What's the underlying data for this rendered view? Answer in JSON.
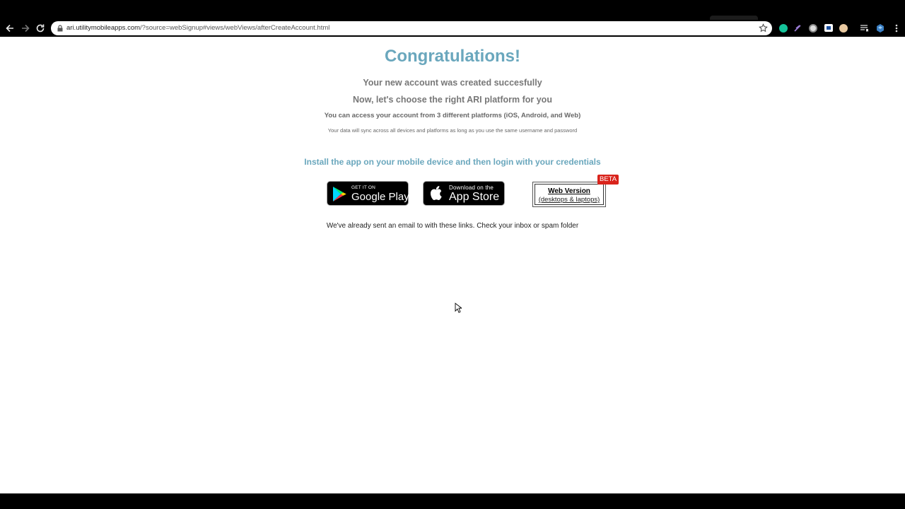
{
  "browser": {
    "url_host": "ari.utilitymobileapps.com",
    "url_rest": "/?source=webSignup#views/webViews/afterCreateAccount.html"
  },
  "page": {
    "title": "Congratulations!",
    "account_created": "Your new account was created succesfully",
    "choose_platform": "Now, let's choose the right ARI platform for you",
    "access_info": "You can access your account from 3 different platforms (iOS, Android, and Web)",
    "sync_info": "Your data will sync across all devices and platforms as long as you use the same username and password",
    "install_prompt": "Install the app on your mobile device and then login with your credentials",
    "email_note": "We've already sent an email to with these links. Check your inbox or spam folder"
  },
  "badges": {
    "google_play": {
      "small": "GET IT ON",
      "big": "Google Play"
    },
    "app_store": {
      "small": "Download on the",
      "big": "App Store"
    }
  },
  "web_version": {
    "title": "Web Version",
    "subtitle": "(desktops & laptops)",
    "beta": "BETA"
  },
  "colors": {
    "accent": "#6aa7bd",
    "beta": "#d9231b"
  }
}
